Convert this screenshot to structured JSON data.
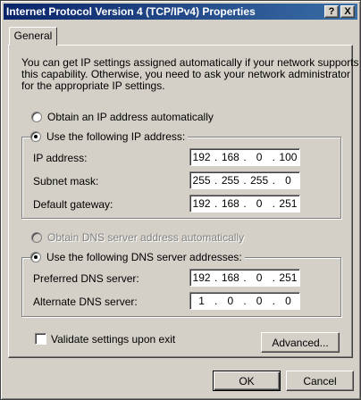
{
  "window": {
    "title": "Internet Protocol Version 4 (TCP/IPv4) Properties",
    "help_label": "?",
    "close_label": "X"
  },
  "tabs": [
    {
      "label": "General"
    }
  ],
  "description": [
    "You can get IP settings assigned automatically if your network supports",
    "this capability. Otherwise, you need to ask your network administrator",
    "for the appropriate IP settings."
  ],
  "ip_section": {
    "obtain_auto": {
      "label": "Obtain an IP address automatically",
      "checked": false
    },
    "use_following": {
      "label": "Use the following IP address:",
      "checked": true
    },
    "fields": [
      {
        "label": "IP address:",
        "octets": [
          "192",
          "168",
          "0",
          "100"
        ]
      },
      {
        "label": "Subnet mask:",
        "octets": [
          "255",
          "255",
          "255",
          "0"
        ]
      },
      {
        "label": "Default gateway:",
        "octets": [
          "192",
          "168",
          "0",
          "251"
        ]
      }
    ]
  },
  "dns_section": {
    "obtain_auto": {
      "label": "Obtain DNS server address automatically",
      "checked": false,
      "disabled": true
    },
    "use_following": {
      "label": "Use the following DNS server addresses:",
      "checked": true
    },
    "fields": [
      {
        "label": "Preferred DNS server:",
        "octets": [
          "192",
          "168",
          "0",
          "251"
        ]
      },
      {
        "label": "Alternate DNS server:",
        "octets": [
          "1",
          "0",
          "0",
          "0"
        ]
      }
    ]
  },
  "validate": {
    "label": "Validate settings upon exit",
    "checked": false
  },
  "buttons": {
    "advanced": "Advanced...",
    "ok": "OK",
    "cancel": "Cancel"
  },
  "colors": {
    "titlebar_start": "#0a246a",
    "titlebar_end": "#3a6ea5",
    "face": "#d4d0c8"
  }
}
